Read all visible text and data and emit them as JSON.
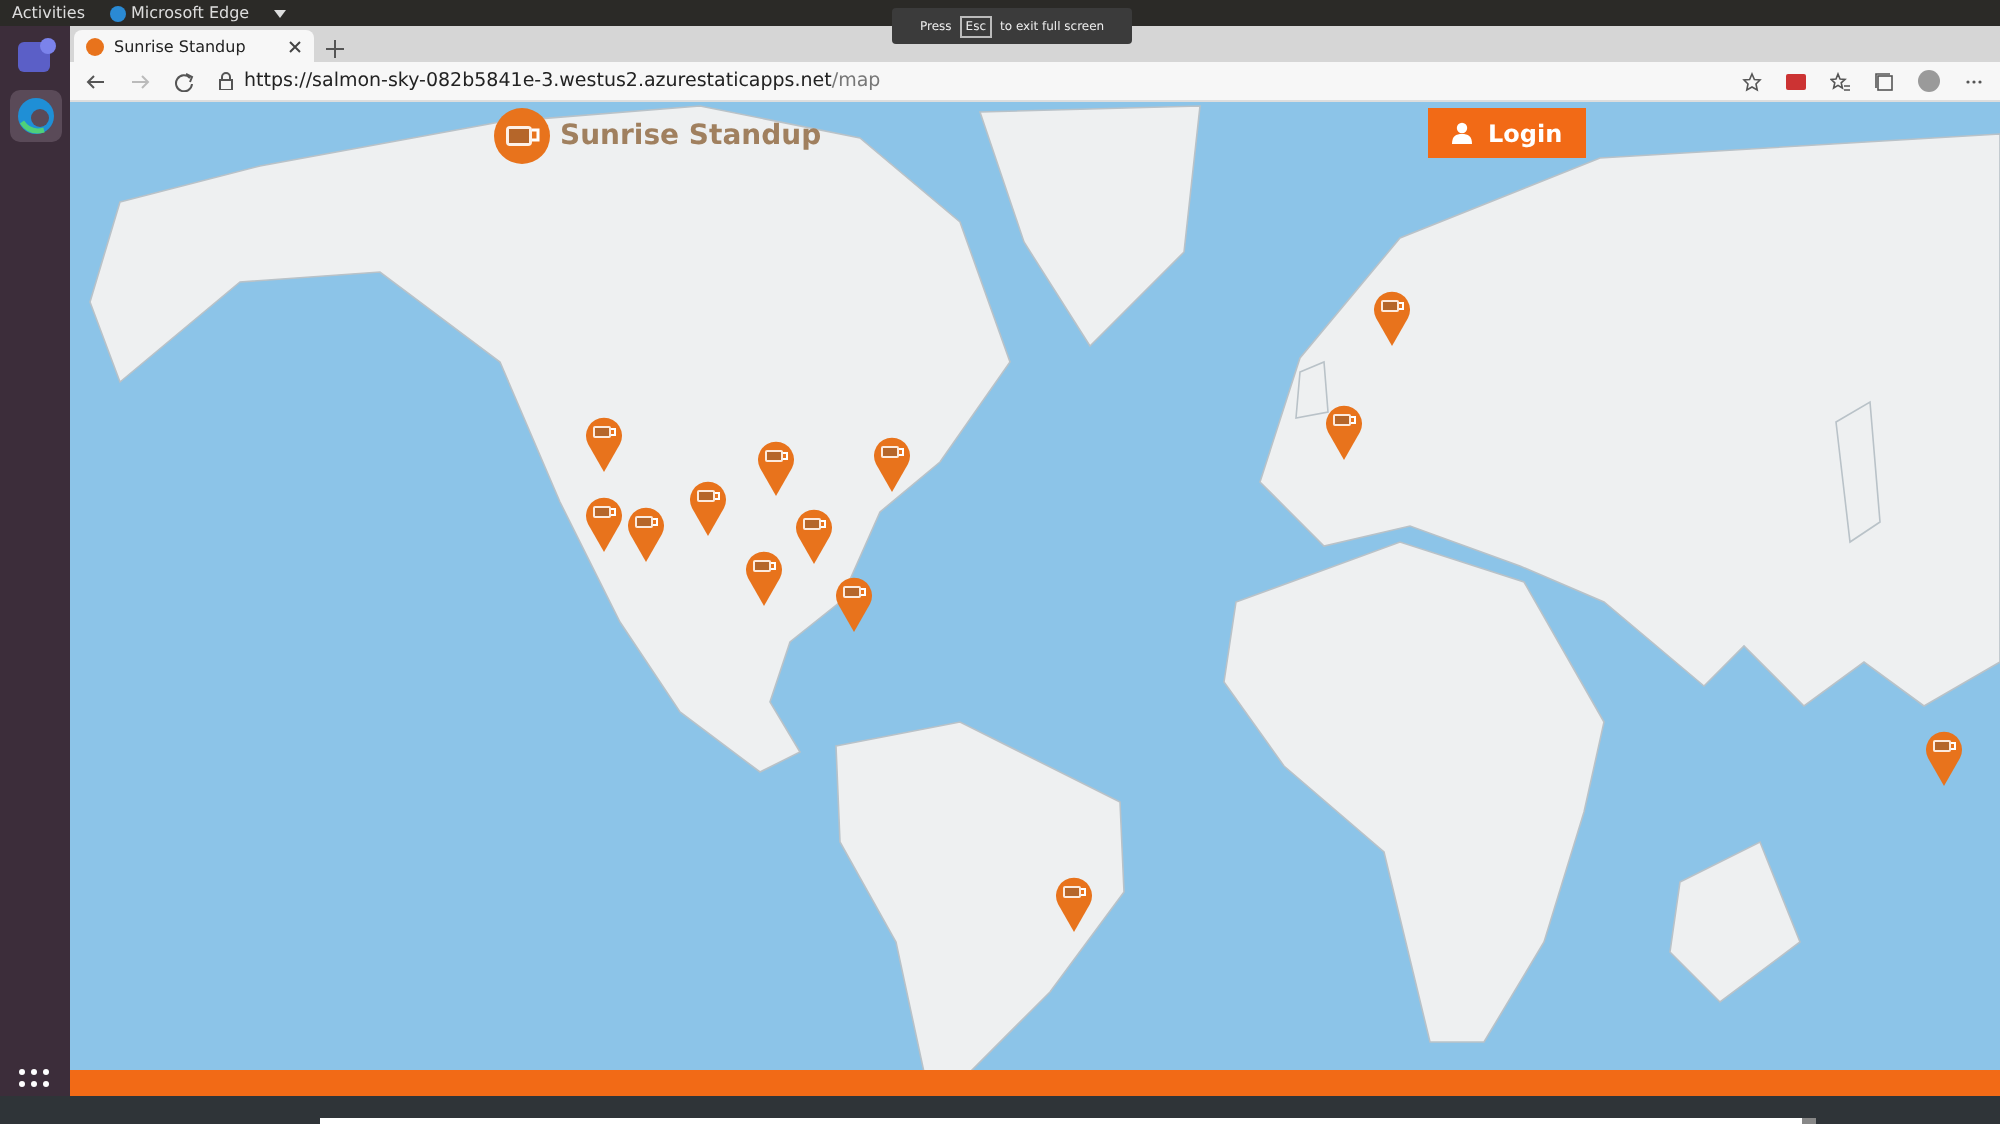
{
  "top_bar": {
    "activities": "Activities",
    "app_menu": "Microsoft Edge"
  },
  "browser": {
    "tab_title": "Sunrise Standup",
    "url_host": "https://salmon-sky-082b5841e-3.westus2.azurestaticapps.net",
    "url_path": "/map"
  },
  "fullscreen_notice": {
    "before": "Press",
    "key": "Esc",
    "after": "to exit full screen"
  },
  "video_player": {
    "level": 0.99
  },
  "site": {
    "logo_text": "Sunrise Standup",
    "login_button": "Login"
  }
}
